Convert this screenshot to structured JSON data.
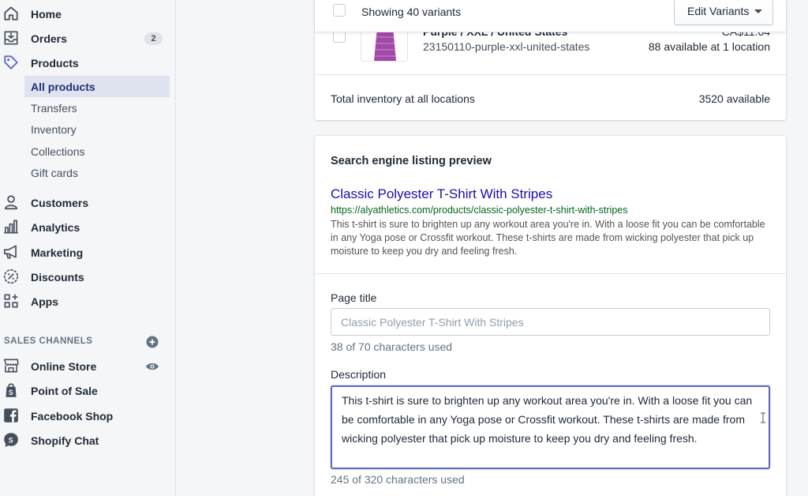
{
  "sidebar": {
    "home": "Home",
    "orders": "Orders",
    "orders_badge": "2",
    "products": "Products",
    "sub_items": [
      "All products",
      "Transfers",
      "Inventory",
      "Collections",
      "Gift cards"
    ],
    "customers": "Customers",
    "analytics": "Analytics",
    "marketing": "Marketing",
    "discounts": "Discounts",
    "apps": "Apps",
    "sales_channels_heading": "SALES CHANNELS",
    "channels": [
      "Online Store",
      "Point of Sale",
      "Facebook Shop",
      "Shopify Chat"
    ]
  },
  "variants_bar": {
    "showing": "Showing 40 variants",
    "edit_button": "Edit Variants"
  },
  "variant": {
    "title": "Purple / XXL / United States",
    "sku": "23150110-purple-xxl-united-states",
    "price": "CA$11.64",
    "availability": "88 available at 1 location"
  },
  "inventory": {
    "label": "Total inventory at all locations",
    "value": "3520 available"
  },
  "seo": {
    "heading": "Search engine listing preview",
    "preview_title": "Classic Polyester T-Shirt With Stripes",
    "preview_url": "https://alyathletics.com/products/classic-polyester-t-shirt-with-stripes",
    "preview_description": "This t-shirt is sure to brighten up any workout area you're in. With a loose fit you can be comfortable in any Yoga pose or Crossfit workout. These t-shirts are made from wicking polyester that pick up moisture to keep you dry and feeling fresh.",
    "page_title_label": "Page title",
    "page_title_placeholder": "Classic Polyester T-Shirt With Stripes",
    "page_title_count": "38 of 70 characters used",
    "description_label": "Description",
    "description_value": "This t-shirt is sure to brighten up any workout area you're in. With a loose fit you can be comfortable in any Yoga pose or Crossfit workout. These t-shirts are made from wicking polyester that pick up moisture to keep you dry and feeling fresh.",
    "description_count": "245 of 320 characters used"
  },
  "colors": {
    "active_nav_bg": "#dfe3f0",
    "active_nav_text": "#202e78",
    "seo_title": "#1a0dab",
    "seo_url": "#006621",
    "focus_border": "#5c6ac4"
  }
}
